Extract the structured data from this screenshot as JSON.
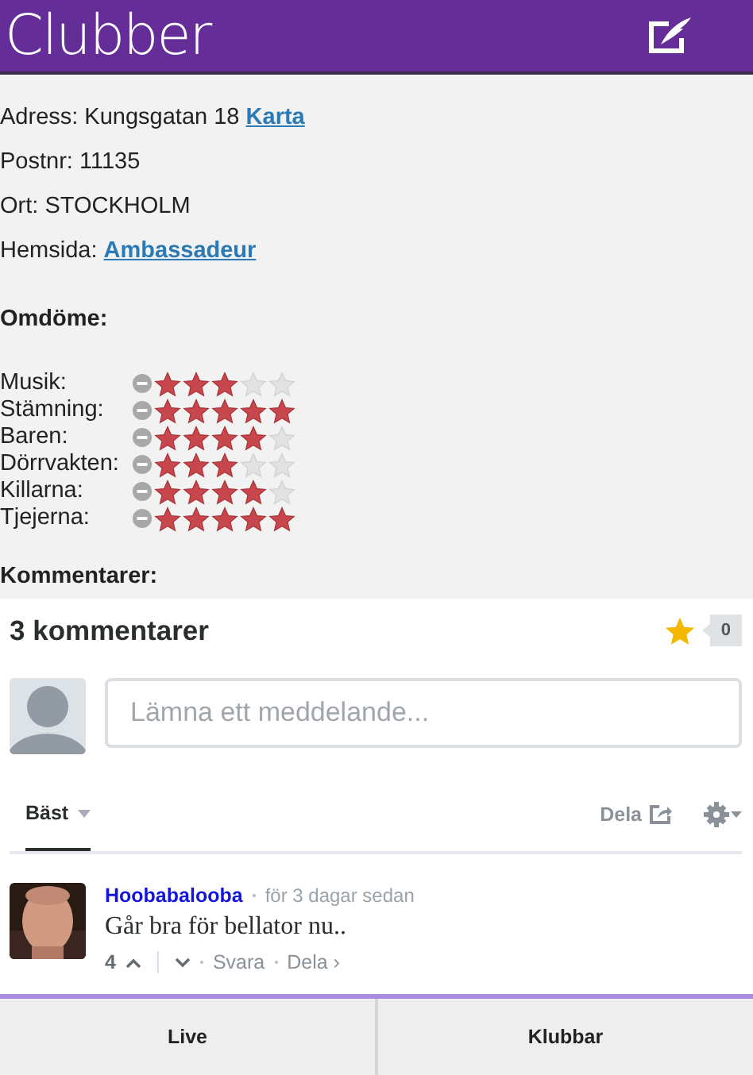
{
  "header": {
    "title": "Clubber"
  },
  "contact": [
    {
      "label": "Adress:",
      "value": "Kungsgatan 18",
      "link": "Karta"
    },
    {
      "label": "Postnr:",
      "value": "11135"
    },
    {
      "label": "Ort:",
      "value": "STOCKHOLM"
    },
    {
      "label": "Hemsida:",
      "link": "Ambassadeur"
    }
  ],
  "ratings": {
    "heading": "Omdöme:",
    "items": [
      {
        "label": "Musik:",
        "stars": 3
      },
      {
        "label": "Stämning:",
        "stars": 5
      },
      {
        "label": "Baren:",
        "stars": 4
      },
      {
        "label": "Dörrvakten:",
        "stars": 3
      },
      {
        "label": "Killarna:",
        "stars": 4
      },
      {
        "label": "Tjejerna:",
        "stars": 5
      }
    ]
  },
  "comments_heading": "Kommentarer:",
  "discussion": {
    "count": "3 kommentarer",
    "favorites": "0",
    "placeholder": "Lämna ett meddelande...",
    "sort": "Bäst",
    "share": "Dela",
    "comments": [
      {
        "author": "Hoobabalooba",
        "time": "för 3 dagar sedan",
        "text": "Går bra för bellator nu..",
        "votes": "4",
        "reply": "Svara",
        "share": "Dela ›"
      }
    ]
  },
  "tabs": [
    {
      "label": "Live"
    },
    {
      "label": "Klubbar"
    }
  ]
}
